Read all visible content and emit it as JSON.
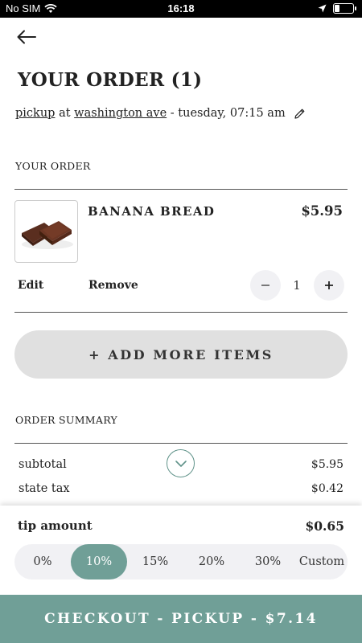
{
  "status_bar": {
    "carrier": "No SIM",
    "time": "16:18",
    "battery_level": 0.25
  },
  "header": {
    "title": "YOUR ORDER (1)"
  },
  "order_meta": {
    "mode": "pickup",
    "at": "at",
    "location": "washington ave",
    "time": "- tuesday, 07:15 am"
  },
  "order_section": {
    "label": "YOUR ORDER"
  },
  "items": [
    {
      "name": "BANANA BREAD",
      "price": "$5.95",
      "quantity": "1",
      "edit_label": "Edit",
      "remove_label": "Remove",
      "minus_label": "−",
      "plus_label": "+"
    }
  ],
  "add_more": {
    "label": "+ ADD MORE ITEMS"
  },
  "summary": {
    "label": "ORDER SUMMARY",
    "rows": [
      {
        "label": "subtotal",
        "value": "$5.95"
      },
      {
        "label": "state tax",
        "value": "$0.42"
      }
    ]
  },
  "tip": {
    "label": "tip amount",
    "value": "$0.65",
    "options": [
      "0%",
      "10%",
      "15%",
      "20%",
      "30%",
      "Custom"
    ],
    "selected": "10%"
  },
  "checkout": {
    "label": "CHECKOUT - PICKUP - $7.14"
  },
  "colors": {
    "accent": "#709f97",
    "accent_outline": "#5f9289",
    "button_gray": "#e0e0e0",
    "pill_bg": "#f1f1f4"
  }
}
